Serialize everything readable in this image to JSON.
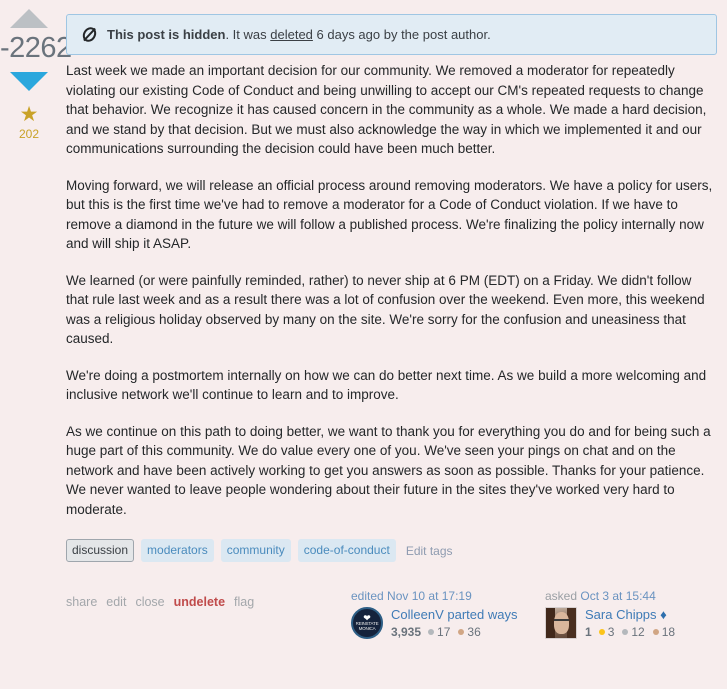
{
  "vote": {
    "score": "-2262",
    "up_arrow_icon": "arrow-up-icon",
    "down_arrow_icon": "arrow-down-icon",
    "favorite_icon": "star-icon",
    "favorite_count": "202",
    "colors": {
      "score": "#6a737c",
      "up_arrow": "#bcc0c4",
      "down_arrow_active": "#2aa7dd",
      "star": "#c9a227"
    }
  },
  "notice": {
    "icon": "crossed-circle-icon",
    "bold_text": "This post is hidden",
    "text_after_bold": ". It was ",
    "link_text": "deleted",
    "text_tail": " 6 days ago by the post author.",
    "background": "#e1ecf4",
    "border": "#9fc6e3"
  },
  "post": {
    "paragraphs": [
      "Last week we made an important decision for our community. We removed a moderator for repeatedly violating our existing Code of Conduct and being unwilling to accept our CM's repeated requests to change that behavior. We recognize it has caused concern in the community as a whole. We made a hard decision, and we stand by that decision. But we must also acknowledge the way in which we implemented it and our communications surrounding the decision could have been much better.",
      "Moving forward, we will release an official process around removing moderators. We have a policy for users, but this is the first time we've had to remove a moderator for a Code of Conduct violation. If we have to remove a diamond in the future we will follow a published process. We're finalizing the policy internally now and will ship it ASAP.",
      "We learned (or were painfully reminded, rather) to never ship at 6 PM (EDT) on a Friday. We didn't follow that rule last week and as a result there was a lot of confusion over the weekend. Even more, this weekend was a religious holiday observed by many on the site. We're sorry for the confusion and uneasiness that caused.",
      "We're doing a postmortem internally on how we can do better next time. As we build a more welcoming and inclusive network we'll continue to learn and to improve.",
      "As we continue on this path to doing better, we want to thank you for everything you do and for being such a huge part of this community. We do value every one of you. We've seen your pings on chat and on the network and have been actively working to get you answers as soon as possible. Thanks for your patience. We never wanted to leave people wondering about their future in the sites they've worked very hard to moderate."
    ],
    "background": "#f7eded"
  },
  "tags": {
    "items": [
      {
        "label": "discussion",
        "style": "required"
      },
      {
        "label": "moderators",
        "style": "normal"
      },
      {
        "label": "community",
        "style": "normal"
      },
      {
        "label": "code-of-conduct",
        "style": "normal"
      }
    ],
    "edit_label": "Edit tags"
  },
  "actions": {
    "items": [
      {
        "label": "share",
        "highlight": false
      },
      {
        "label": "edit",
        "highlight": false
      },
      {
        "label": "close",
        "highlight": false
      },
      {
        "label": "undelete",
        "highlight": true
      },
      {
        "label": "flag",
        "highlight": false
      }
    ],
    "highlight_color": "#c04b4b"
  },
  "editor_card": {
    "action_label": "edited",
    "timestamp": "Nov 10 at 17:19",
    "avatar_icon": "reinstate-monica-avatar",
    "avatar_label": "REINSTATE MONICA",
    "username": "ColleenV parted ways",
    "reputation": "3,935",
    "badges": [
      {
        "tier": "silver",
        "count": "17"
      },
      {
        "tier": "bronze",
        "count": "36"
      }
    ]
  },
  "asker_card": {
    "action_label": "asked",
    "timestamp": "Oct 3 at 15:44",
    "avatar_icon": "user-photo-avatar",
    "username": "Sara Chipps",
    "moderator_diamond": "♦",
    "reputation": "1",
    "badges": [
      {
        "tier": "gold",
        "count": "3"
      },
      {
        "tier": "silver",
        "count": "12"
      },
      {
        "tier": "bronze",
        "count": "18"
      }
    ]
  }
}
